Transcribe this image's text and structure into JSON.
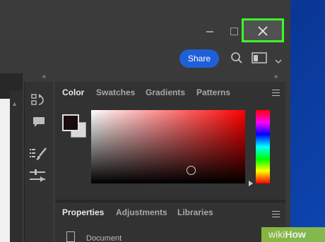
{
  "titlebar": {
    "minimize_icon": "minimize-icon",
    "maximize_icon": "maximize-icon",
    "close_icon": "close-icon",
    "highlight_color": "#3ef72a"
  },
  "toolbar": {
    "share_label": "Share",
    "share_color": "#1f5fd8",
    "search_icon": "search-icon",
    "workspace_icon": "workspace-icon",
    "workspace_chevron": "chevron-down-icon"
  },
  "collapse": {
    "left": "‹‹",
    "right": "››"
  },
  "color_panel": {
    "tabs": [
      {
        "label": "Color",
        "active": true
      },
      {
        "label": "Swatches",
        "active": false
      },
      {
        "label": "Gradients",
        "active": false
      },
      {
        "label": "Patterns",
        "active": false
      }
    ],
    "foreground_color": "#1a0c0c",
    "background_color": "#d9d9d9",
    "picker_hue": "#ff0000"
  },
  "properties_panel": {
    "tabs": [
      {
        "label": "Properties",
        "active": true
      },
      {
        "label": "Adjustments",
        "active": false
      },
      {
        "label": "Libraries",
        "active": false
      }
    ],
    "item_label": "Document"
  },
  "watermark": {
    "wiki": "wiki",
    "how": "How"
  }
}
